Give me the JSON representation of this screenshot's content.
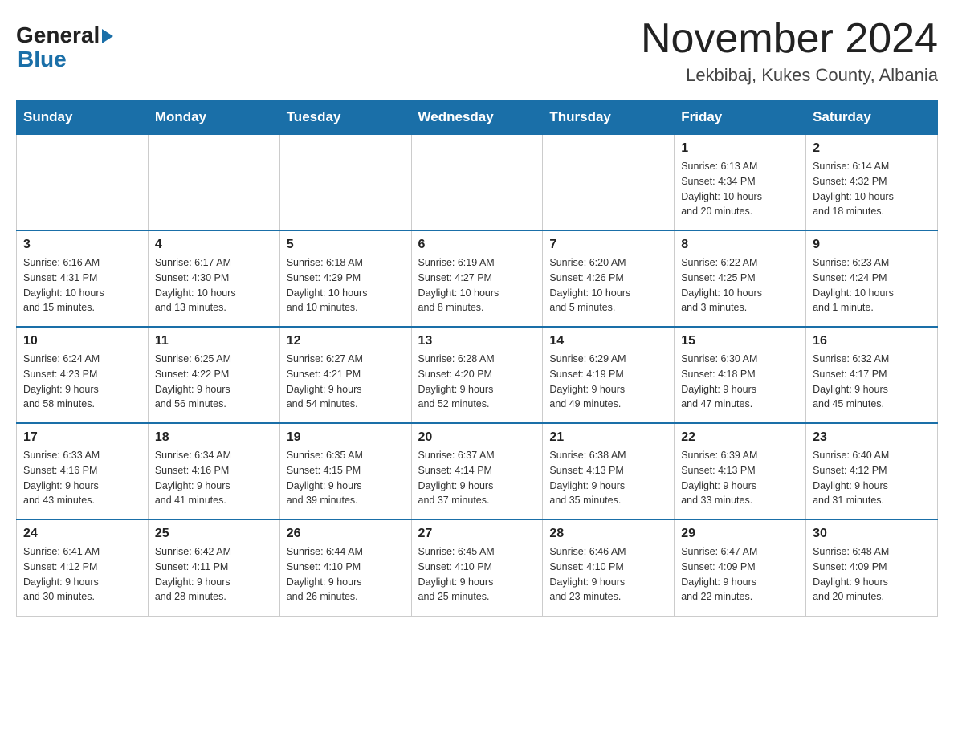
{
  "header": {
    "logo_text_general": "General",
    "logo_text_blue": "Blue",
    "month_year": "November 2024",
    "location": "Lekbibaj, Kukes County, Albania"
  },
  "weekdays": [
    "Sunday",
    "Monday",
    "Tuesday",
    "Wednesday",
    "Thursday",
    "Friday",
    "Saturday"
  ],
  "weeks": [
    [
      {
        "day": "",
        "info": ""
      },
      {
        "day": "",
        "info": ""
      },
      {
        "day": "",
        "info": ""
      },
      {
        "day": "",
        "info": ""
      },
      {
        "day": "",
        "info": ""
      },
      {
        "day": "1",
        "info": "Sunrise: 6:13 AM\nSunset: 4:34 PM\nDaylight: 10 hours\nand 20 minutes."
      },
      {
        "day": "2",
        "info": "Sunrise: 6:14 AM\nSunset: 4:32 PM\nDaylight: 10 hours\nand 18 minutes."
      }
    ],
    [
      {
        "day": "3",
        "info": "Sunrise: 6:16 AM\nSunset: 4:31 PM\nDaylight: 10 hours\nand 15 minutes."
      },
      {
        "day": "4",
        "info": "Sunrise: 6:17 AM\nSunset: 4:30 PM\nDaylight: 10 hours\nand 13 minutes."
      },
      {
        "day": "5",
        "info": "Sunrise: 6:18 AM\nSunset: 4:29 PM\nDaylight: 10 hours\nand 10 minutes."
      },
      {
        "day": "6",
        "info": "Sunrise: 6:19 AM\nSunset: 4:27 PM\nDaylight: 10 hours\nand 8 minutes."
      },
      {
        "day": "7",
        "info": "Sunrise: 6:20 AM\nSunset: 4:26 PM\nDaylight: 10 hours\nand 5 minutes."
      },
      {
        "day": "8",
        "info": "Sunrise: 6:22 AM\nSunset: 4:25 PM\nDaylight: 10 hours\nand 3 minutes."
      },
      {
        "day": "9",
        "info": "Sunrise: 6:23 AM\nSunset: 4:24 PM\nDaylight: 10 hours\nand 1 minute."
      }
    ],
    [
      {
        "day": "10",
        "info": "Sunrise: 6:24 AM\nSunset: 4:23 PM\nDaylight: 9 hours\nand 58 minutes."
      },
      {
        "day": "11",
        "info": "Sunrise: 6:25 AM\nSunset: 4:22 PM\nDaylight: 9 hours\nand 56 minutes."
      },
      {
        "day": "12",
        "info": "Sunrise: 6:27 AM\nSunset: 4:21 PM\nDaylight: 9 hours\nand 54 minutes."
      },
      {
        "day": "13",
        "info": "Sunrise: 6:28 AM\nSunset: 4:20 PM\nDaylight: 9 hours\nand 52 minutes."
      },
      {
        "day": "14",
        "info": "Sunrise: 6:29 AM\nSunset: 4:19 PM\nDaylight: 9 hours\nand 49 minutes."
      },
      {
        "day": "15",
        "info": "Sunrise: 6:30 AM\nSunset: 4:18 PM\nDaylight: 9 hours\nand 47 minutes."
      },
      {
        "day": "16",
        "info": "Sunrise: 6:32 AM\nSunset: 4:17 PM\nDaylight: 9 hours\nand 45 minutes."
      }
    ],
    [
      {
        "day": "17",
        "info": "Sunrise: 6:33 AM\nSunset: 4:16 PM\nDaylight: 9 hours\nand 43 minutes."
      },
      {
        "day": "18",
        "info": "Sunrise: 6:34 AM\nSunset: 4:16 PM\nDaylight: 9 hours\nand 41 minutes."
      },
      {
        "day": "19",
        "info": "Sunrise: 6:35 AM\nSunset: 4:15 PM\nDaylight: 9 hours\nand 39 minutes."
      },
      {
        "day": "20",
        "info": "Sunrise: 6:37 AM\nSunset: 4:14 PM\nDaylight: 9 hours\nand 37 minutes."
      },
      {
        "day": "21",
        "info": "Sunrise: 6:38 AM\nSunset: 4:13 PM\nDaylight: 9 hours\nand 35 minutes."
      },
      {
        "day": "22",
        "info": "Sunrise: 6:39 AM\nSunset: 4:13 PM\nDaylight: 9 hours\nand 33 minutes."
      },
      {
        "day": "23",
        "info": "Sunrise: 6:40 AM\nSunset: 4:12 PM\nDaylight: 9 hours\nand 31 minutes."
      }
    ],
    [
      {
        "day": "24",
        "info": "Sunrise: 6:41 AM\nSunset: 4:12 PM\nDaylight: 9 hours\nand 30 minutes."
      },
      {
        "day": "25",
        "info": "Sunrise: 6:42 AM\nSunset: 4:11 PM\nDaylight: 9 hours\nand 28 minutes."
      },
      {
        "day": "26",
        "info": "Sunrise: 6:44 AM\nSunset: 4:10 PM\nDaylight: 9 hours\nand 26 minutes."
      },
      {
        "day": "27",
        "info": "Sunrise: 6:45 AM\nSunset: 4:10 PM\nDaylight: 9 hours\nand 25 minutes."
      },
      {
        "day": "28",
        "info": "Sunrise: 6:46 AM\nSunset: 4:10 PM\nDaylight: 9 hours\nand 23 minutes."
      },
      {
        "day": "29",
        "info": "Sunrise: 6:47 AM\nSunset: 4:09 PM\nDaylight: 9 hours\nand 22 minutes."
      },
      {
        "day": "30",
        "info": "Sunrise: 6:48 AM\nSunset: 4:09 PM\nDaylight: 9 hours\nand 20 minutes."
      }
    ]
  ]
}
